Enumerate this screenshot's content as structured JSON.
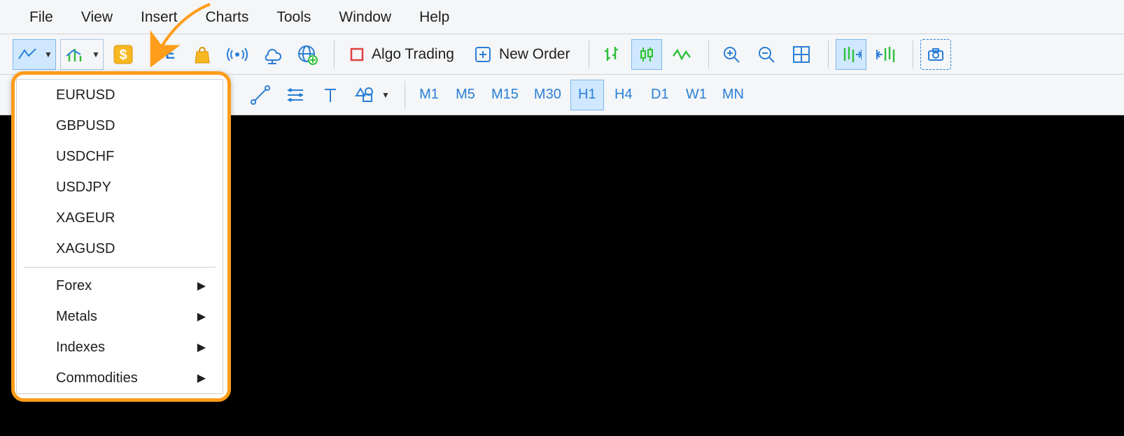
{
  "menubar": {
    "items": [
      "File",
      "View",
      "Insert",
      "Charts",
      "Tools",
      "Window",
      "Help"
    ]
  },
  "toolbar1": {
    "ide_label": "IDE",
    "algo_label": "Algo Trading",
    "new_order_label": "New Order"
  },
  "toolbar2": {
    "timeframes": [
      "M1",
      "M5",
      "M15",
      "M30",
      "H1",
      "H4",
      "D1",
      "W1",
      "MN"
    ],
    "selected": "H1"
  },
  "symbol_dropdown": {
    "symbols": [
      "EURUSD",
      "GBPUSD",
      "USDCHF",
      "USDJPY",
      "XAGEUR",
      "XAGUSD"
    ],
    "categories": [
      "Forex",
      "Metals",
      "Indexes",
      "Commodities"
    ]
  }
}
